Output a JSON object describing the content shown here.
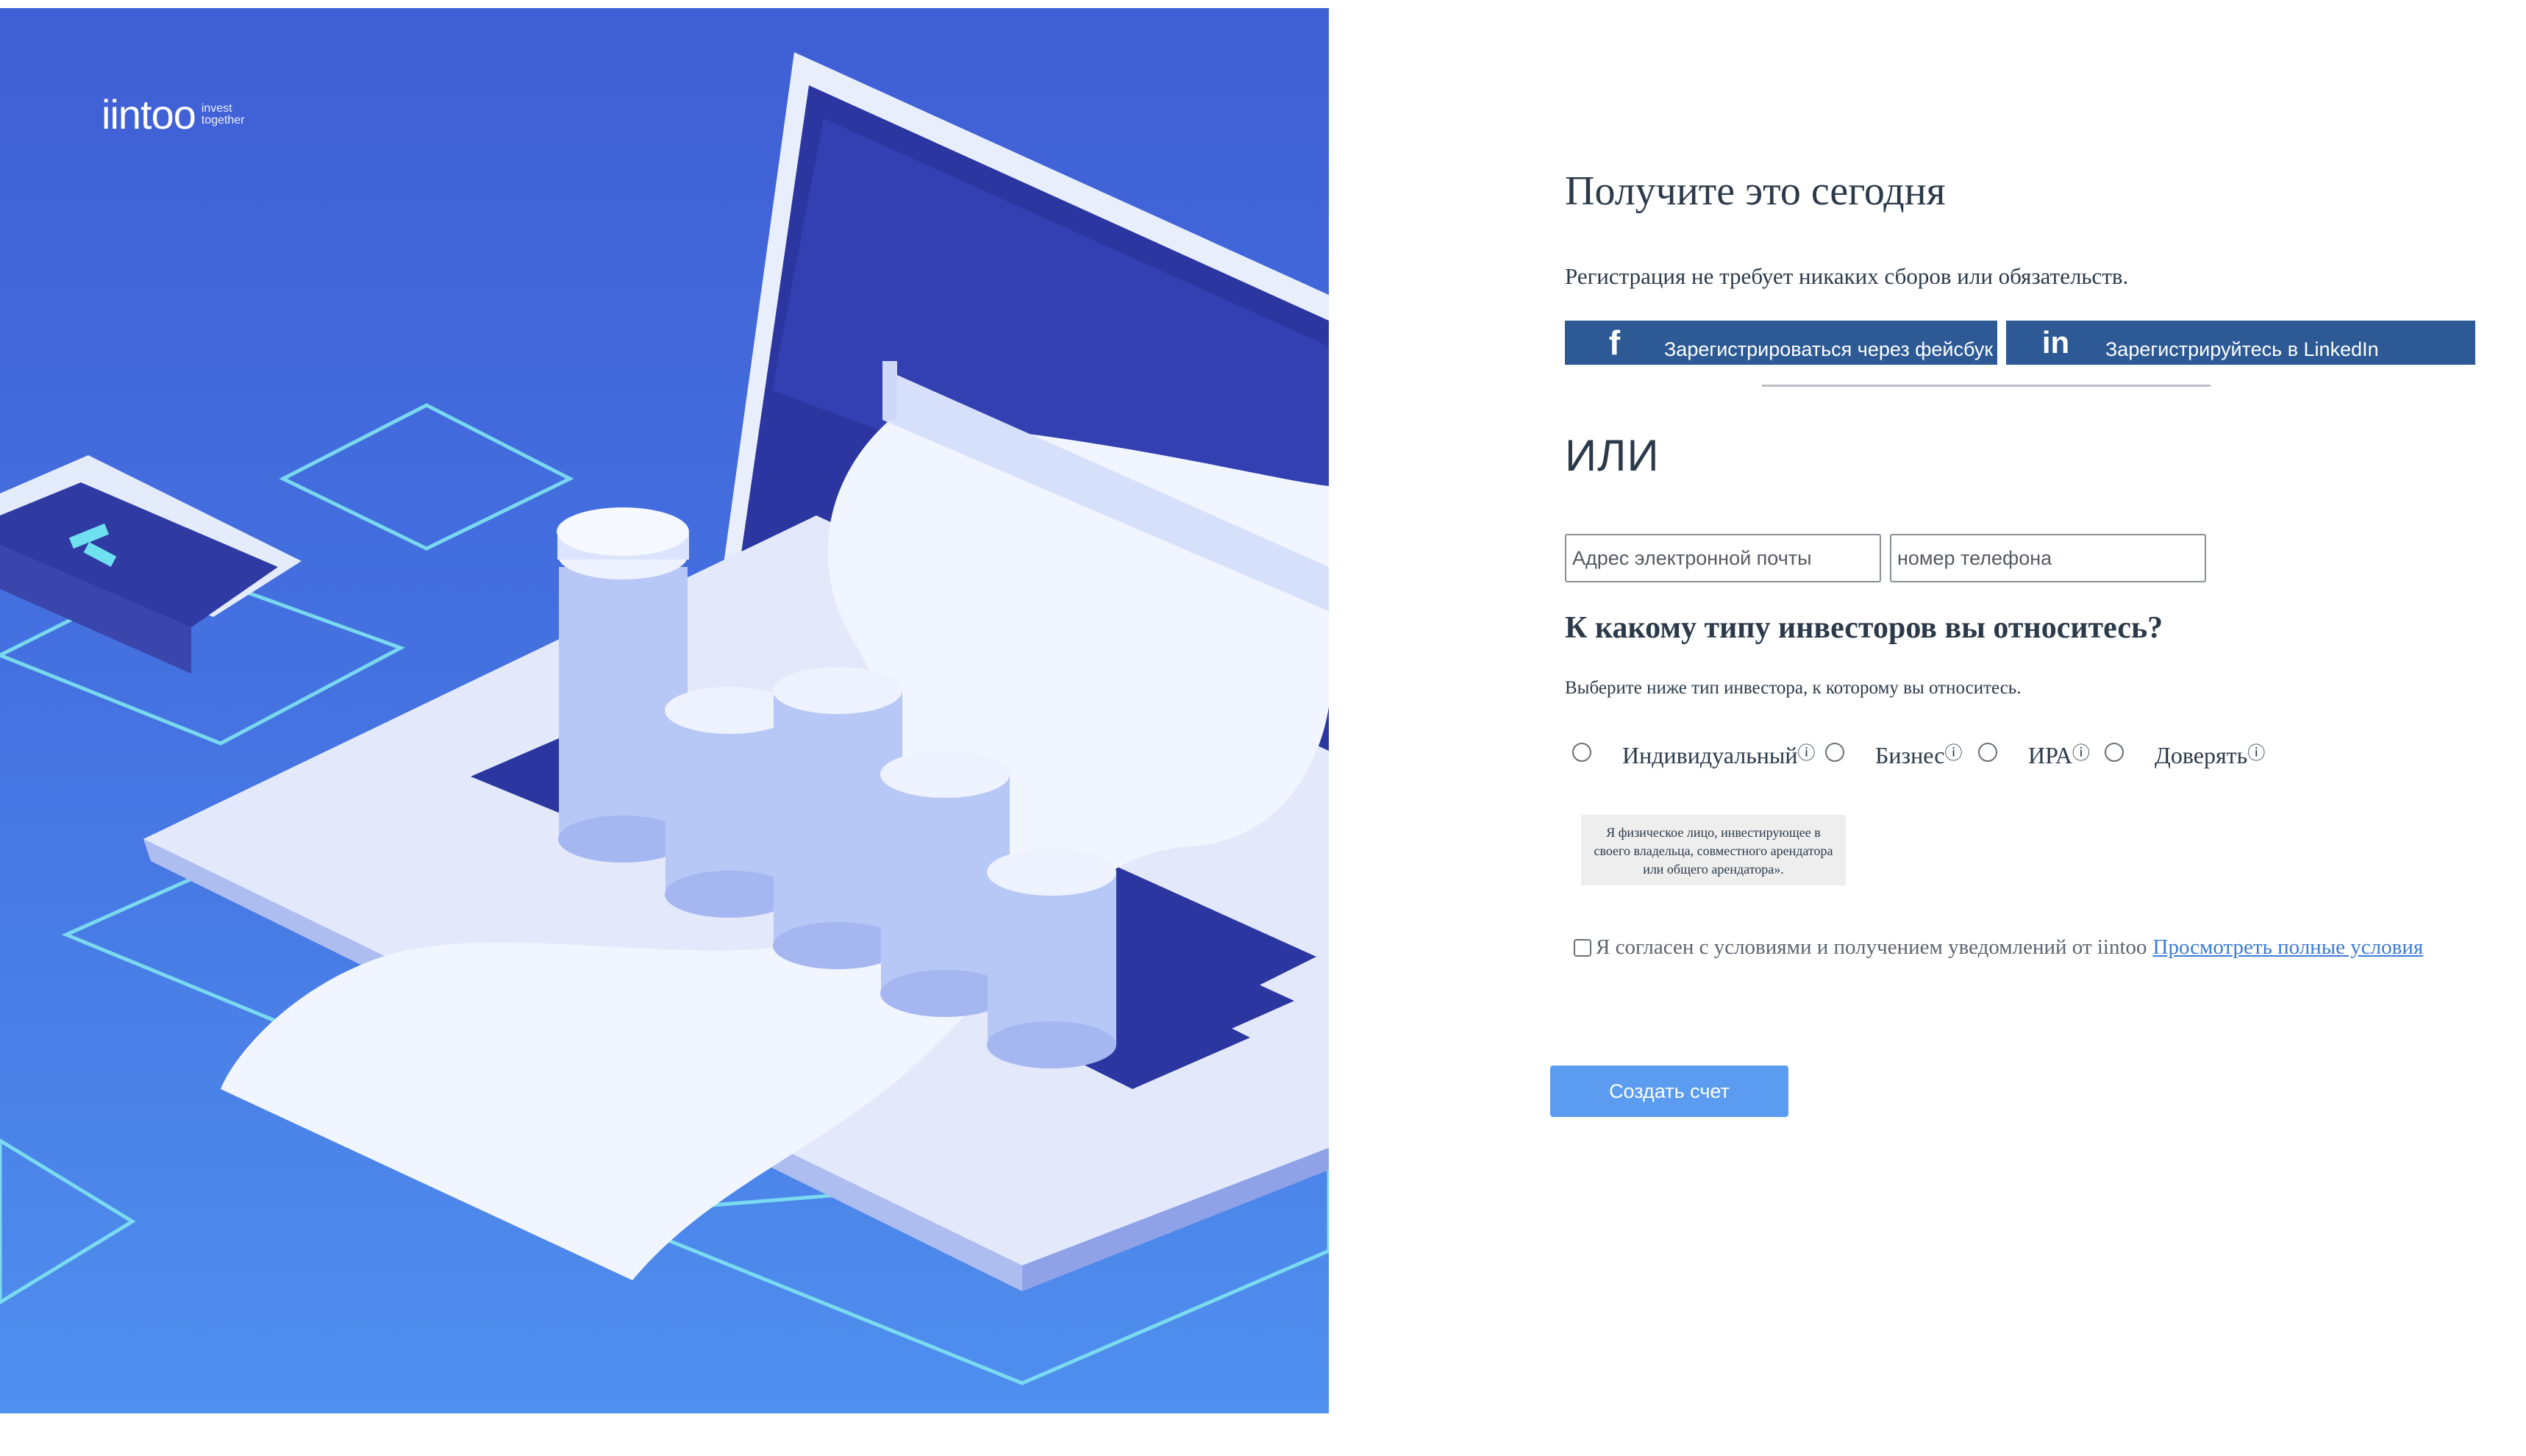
{
  "brand": {
    "name": "iintoo",
    "tagline_line1": "invest",
    "tagline_line2": "together"
  },
  "form": {
    "title": "Получите это сегодня",
    "subtitle": "Регистрация не требует никаких сборов или обязательств.",
    "facebook": {
      "icon": "facebook-icon",
      "glyph": "f",
      "label": "Зарегистрироваться через фейсбук"
    },
    "linkedin": {
      "icon": "linkedin-icon",
      "glyph": "in",
      "label": "Зарегистрируйтесь в LinkedIn"
    },
    "or_text": "ИЛИ",
    "email": {
      "placeholder": "Адрес электронной почты",
      "value": ""
    },
    "phone": {
      "placeholder": "номер телефона",
      "value": ""
    },
    "investor_question": "К какому типу инвесторов вы относитесь?",
    "investor_hint": "Выберите ниже тип инвестора, к которому вы относитесь.",
    "investor_types": [
      {
        "label": "Индивидуальный",
        "info": "ⓘ",
        "selected": false
      },
      {
        "label": "Бизнес",
        "info": "ⓘ",
        "selected": false
      },
      {
        "label": "ИРА",
        "info": "ⓘ",
        "selected": false
      },
      {
        "label": "Доверять",
        "info": "ⓘ",
        "selected": false
      }
    ],
    "tooltip": "Я физическое лицо, инвестирующее в своего владельца, совместного арендатора или общего арендатора».",
    "agree_text": "Я согласен с условиями и получением уведомлений от iintoo",
    "terms_link": "Просмотреть полные условия",
    "agree_checked": false,
    "submit_label": "Создать счет"
  },
  "colors": {
    "social_button": "#2d5a95",
    "primary_button": "#5b9cf0",
    "link": "#3a7bd5",
    "hero_background": "#4470e0"
  }
}
